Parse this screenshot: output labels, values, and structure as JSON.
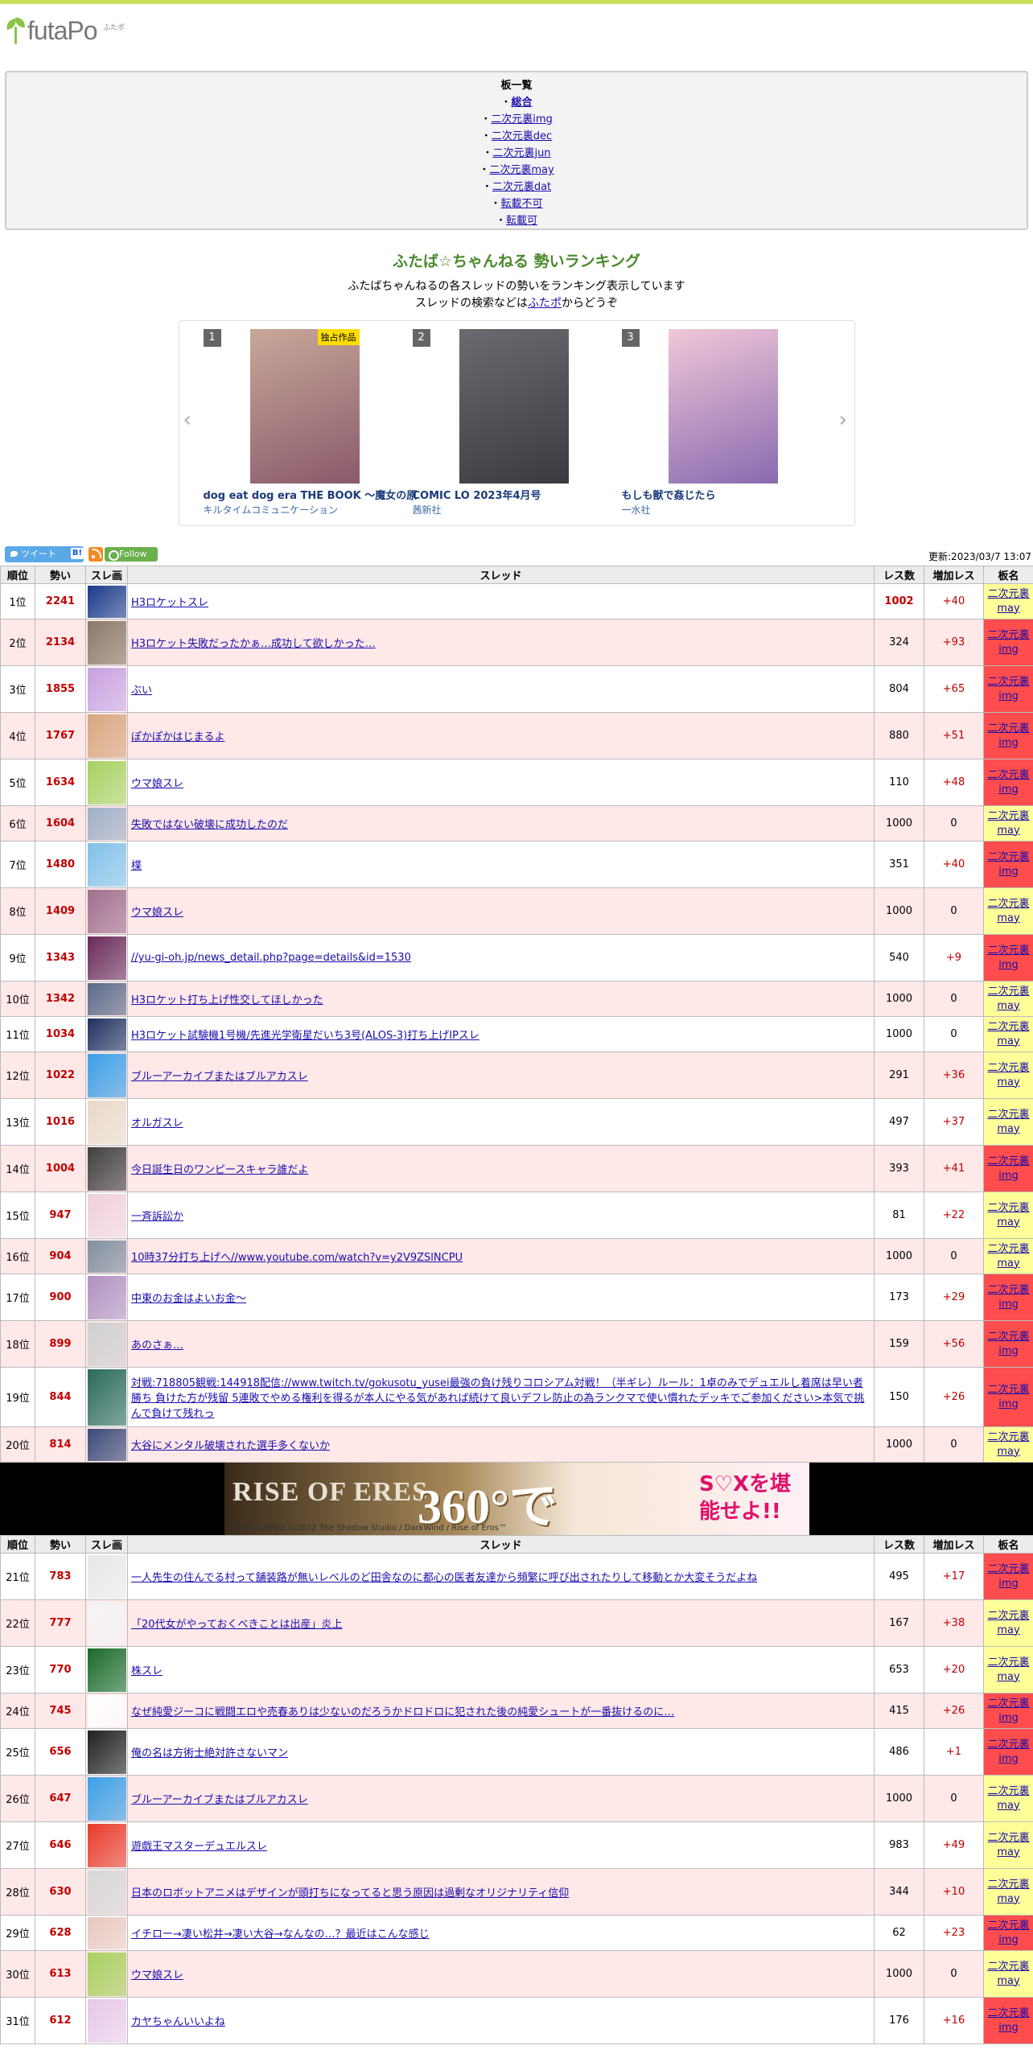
{
  "site": {
    "logo_text": "futaPo",
    "logo_small": "ふたポ"
  },
  "boards": {
    "heading": "板一覧",
    "items": [
      "総合",
      "二次元裏img",
      "二次元裏dec",
      "二次元裏jun",
      "二次元裏may",
      "二次元裏dat",
      "転載不可",
      "転載可"
    ]
  },
  "ranking": {
    "title": "ふたば☆ちゃんねる 勢いランキング",
    "desc1": "ふたばちゃんねるの各スレッドの勢いをランキング表示しています",
    "desc2_pre": "スレッドの検索などは",
    "desc2_link": "ふたポ",
    "desc2_post": "からどうぞ"
  },
  "carousel": [
    {
      "num": "1",
      "title": "dog eat dog era THE BOOK ～魔女の原",
      "publisher": "キルタイムコミュニケーション",
      "badge": "独占作品"
    },
    {
      "num": "2",
      "title": "COMIC LO 2023年4月号",
      "publisher": "茜新社",
      "badge": ""
    },
    {
      "num": "3",
      "title": "もしも獣で姦じたら",
      "publisher": "一水社",
      "badge": ""
    }
  ],
  "toolbar": {
    "tweet": "ツイート",
    "hatena": "B!",
    "follow": "Follow",
    "updated": "更新:2023/03/7 13:07"
  },
  "table": {
    "headers": [
      "順位",
      "勢い",
      "スレ画",
      "スレッド",
      "レス数",
      "増加レス",
      "板名"
    ]
  },
  "rows_a": [
    {
      "rank": "1位",
      "ikioi": "2241",
      "title": "H3ロケットスレ",
      "res": "1002",
      "inc": "+40",
      "board": [
        "二次元裏",
        "may"
      ],
      "bt": "may",
      "hot": true,
      "thumb": "#1a3a8a"
    },
    {
      "rank": "2位",
      "ikioi": "2134",
      "title": "H3ロケット失敗だったかぁ…成功して欲しかった…",
      "res": "324",
      "inc": "+93",
      "board": [
        "二次元裏",
        "img"
      ],
      "bt": "img",
      "thumb": "#8a7a6a"
    },
    {
      "rank": "3位",
      "ikioi": "1855",
      "title": "ぶい",
      "res": "804",
      "inc": "+65",
      "board": [
        "二次元裏",
        "img"
      ],
      "bt": "img",
      "thumb": "#c8a0e0"
    },
    {
      "rank": "4位",
      "ikioi": "1767",
      "title": "ぽかぽかはじまるよ",
      "res": "880",
      "inc": "+51",
      "board": [
        "二次元裏",
        "img"
      ],
      "bt": "img",
      "thumb": "#d8a880"
    },
    {
      "rank": "5位",
      "ikioi": "1634",
      "title": "ウマ娘スレ",
      "res": "110",
      "inc": "+48",
      "board": [
        "二次元裏",
        "img"
      ],
      "bt": "img",
      "thumb": "#a8d060"
    },
    {
      "rank": "6位",
      "ikioi": "1604",
      "title": "失敗ではない破壊に成功したのだ",
      "res": "1000",
      "inc": "0",
      "board": [
        "二次元裏",
        "may"
      ],
      "bt": "may",
      "thumb": "#a0b0c8"
    },
    {
      "rank": "7位",
      "ikioi": "1480",
      "title": "楪",
      "res": "351",
      "inc": "+40",
      "board": [
        "二次元裏",
        "img"
      ],
      "bt": "img",
      "thumb": "#80c0e8"
    },
    {
      "rank": "8位",
      "ikioi": "1409",
      "title": "ウマ娘スレ",
      "res": "1000",
      "inc": "0",
      "board": [
        "二次元裏",
        "may"
      ],
      "bt": "may",
      "thumb": "#a07090"
    },
    {
      "rank": "9位",
      "ikioi": "1343",
      "title": "//yu-gi-oh.jp/news_detail.php?page=details&id=1530",
      "res": "540",
      "inc": "+9",
      "board": [
        "二次元裏",
        "img"
      ],
      "bt": "img",
      "thumb": "#6a2a5a"
    },
    {
      "rank": "10位",
      "ikioi": "1342",
      "title": "H3ロケット打ち上げ性交してほしかった",
      "res": "1000",
      "inc": "0",
      "board": [
        "二次元裏",
        "may"
      ],
      "bt": "may",
      "thumb": "#5a6a8a"
    },
    {
      "rank": "11位",
      "ikioi": "1034",
      "title": "H3ロケット試験機1号機/先進光学衛星だいち3号(ALOS-3)打ち上げIPスレ",
      "res": "1000",
      "inc": "0",
      "board": [
        "二次元裏",
        "may"
      ],
      "bt": "may",
      "thumb": "#203060"
    },
    {
      "rank": "12位",
      "ikioi": "1022",
      "title": "ブルーアーカイブまたはブルアカスレ",
      "res": "291",
      "inc": "+36",
      "board": [
        "二次元裏",
        "may"
      ],
      "bt": "may",
      "thumb": "#3aa0e8"
    },
    {
      "rank": "13位",
      "ikioi": "1016",
      "title": "オルガスレ",
      "res": "497",
      "inc": "+37",
      "board": [
        "二次元裏",
        "may"
      ],
      "bt": "may",
      "thumb": "#e8d8c8"
    },
    {
      "rank": "14位",
      "ikioi": "1004",
      "title": "今日誕生日のワンピースキャラ誰だよ",
      "res": "393",
      "inc": "+41",
      "board": [
        "二次元裏",
        "img"
      ],
      "bt": "img",
      "thumb": "#404040"
    },
    {
      "rank": "15位",
      "ikioi": "947",
      "title": "一斉訴訟か",
      "res": "81",
      "inc": "+22",
      "board": [
        "二次元裏",
        "may"
      ],
      "bt": "may",
      "thumb": "#f0d0d8"
    },
    {
      "rank": "16位",
      "ikioi": "904",
      "title": "10時37分打ち上げへ//www.youtube.com/watch?v=y2V9ZSlNCPU",
      "res": "1000",
      "inc": "0",
      "board": [
        "二次元裏",
        "may"
      ],
      "bt": "may",
      "thumb": "#8090a0"
    },
    {
      "rank": "17位",
      "ikioi": "900",
      "title": "中東のお金はよいお金～",
      "res": "173",
      "inc": "+29",
      "board": [
        "二次元裏",
        "img"
      ],
      "bt": "img",
      "thumb": "#b090c0"
    },
    {
      "rank": "18位",
      "ikioi": "899",
      "title": "あのさぁ…",
      "res": "159",
      "inc": "+56",
      "board": [
        "二次元裏",
        "img"
      ],
      "bt": "img",
      "thumb": "#d0d0d0"
    },
    {
      "rank": "19位",
      "ikioi": "844",
      "title": "対戦:718805観戦:144918配信://www.twitch.tv/gokusotu_yusei最強の負け残りコロシアム対戦！（半ギレ）ルール：1卓のみでデュエルし着席は早い者勝ち 負けた方が残留 5連敗でやめる権利を得るが本人にやる気があれば続けて良いデフレ防止の為ランクマで使い慣れたデッキでご参加ください>本気で挑んで負けて残れっ",
      "res": "150",
      "inc": "+26",
      "board": [
        "二次元裏",
        "img"
      ],
      "bt": "img",
      "thumb": "#2a6a5a"
    },
    {
      "rank": "20位",
      "ikioi": "814",
      "title": "大谷にメンタル破壊された選手多くないか",
      "res": "1000",
      "inc": "0",
      "board": [
        "二次元裏",
        "may"
      ],
      "bt": "may",
      "thumb": "#3a4a7a"
    }
  ],
  "ad": {
    "logo": "RISE OF ERES",
    "big": "360°で",
    "copy_text": "S♡Xを堪能せよ!!",
    "credit": "FANZA GAMES ©2022 The Shadow Studio / DarkWind / Rise of Eros™"
  },
  "rows_b": [
    {
      "rank": "21位",
      "ikioi": "783",
      "title": "一人先生の住んでる村って舗装路が無いレベルのど田舎なのに都心の医者友達から頻繁に呼び出されたりして移動とか大変そうだよね",
      "res": "495",
      "inc": "+17",
      "board": [
        "二次元裏",
        "img"
      ],
      "bt": "img",
      "thumb": "#e8e8e8"
    },
    {
      "rank": "22位",
      "ikioi": "777",
      "title": "「20代女がやっておくべきことは出産」炎上",
      "res": "167",
      "inc": "+38",
      "board": [
        "二次元裏",
        "may"
      ],
      "bt": "may",
      "thumb": "#f4f4f4"
    },
    {
      "rank": "23位",
      "ikioi": "770",
      "title": "株スレ",
      "res": "653",
      "inc": "+20",
      "board": [
        "二次元裏",
        "may"
      ],
      "bt": "may",
      "thumb": "#1a6a2a"
    },
    {
      "rank": "24位",
      "ikioi": "745",
      "title": "なぜ純愛ジーコに戦闘エロや売春ありは少ないのだろうかドロドロに犯された後の純愛シュートが一番抜けるのに…",
      "res": "415",
      "inc": "+26",
      "board": [
        "二次元裏",
        "img"
      ],
      "bt": "img",
      "thumb": "#ffffff"
    },
    {
      "rank": "25位",
      "ikioi": "656",
      "title": "俺の名は方術士絶対許さないマン",
      "res": "486",
      "inc": "+1",
      "board": [
        "二次元裏",
        "img"
      ],
      "bt": "img",
      "thumb": "#202020"
    },
    {
      "rank": "26位",
      "ikioi": "647",
      "title": "ブルーアーカイブまたはブルアカスレ",
      "res": "1000",
      "inc": "0",
      "board": [
        "二次元裏",
        "may"
      ],
      "bt": "may",
      "thumb": "#3aa0e8"
    },
    {
      "rank": "27位",
      "ikioi": "646",
      "title": "遊戯王マスターデュエルスレ",
      "res": "983",
      "inc": "+49",
      "board": [
        "二次元裏",
        "may"
      ],
      "bt": "may",
      "thumb": "#e83a2a"
    },
    {
      "rank": "28位",
      "ikioi": "630",
      "title": "日本のロボットアニメはデザインが頭打ちになってると思う原因は過剰なオリジナリティ信仰",
      "res": "344",
      "inc": "+10",
      "board": [
        "二次元裏",
        "may"
      ],
      "bt": "may",
      "thumb": "#d8d8d8"
    },
    {
      "rank": "29位",
      "ikioi": "628",
      "title": "イチロー→凄い松井→凄い大谷→なんなの…？最近はこんな感じ",
      "res": "62",
      "inc": "+23",
      "board": [
        "二次元裏",
        "img"
      ],
      "bt": "img",
      "thumb": "#e8c8c0"
    },
    {
      "rank": "30位",
      "ikioi": "613",
      "title": "ウマ娘スレ",
      "res": "1000",
      "inc": "0",
      "board": [
        "二次元裏",
        "may"
      ],
      "bt": "may",
      "thumb": "#a8d060"
    },
    {
      "rank": "31位",
      "ikioi": "612",
      "title": "カヤちゃんいいよね",
      "res": "176",
      "inc": "+16",
      "board": [
        "二次元裏",
        "img"
      ],
      "bt": "img",
      "thumb": "#e8c8e8"
    }
  ]
}
